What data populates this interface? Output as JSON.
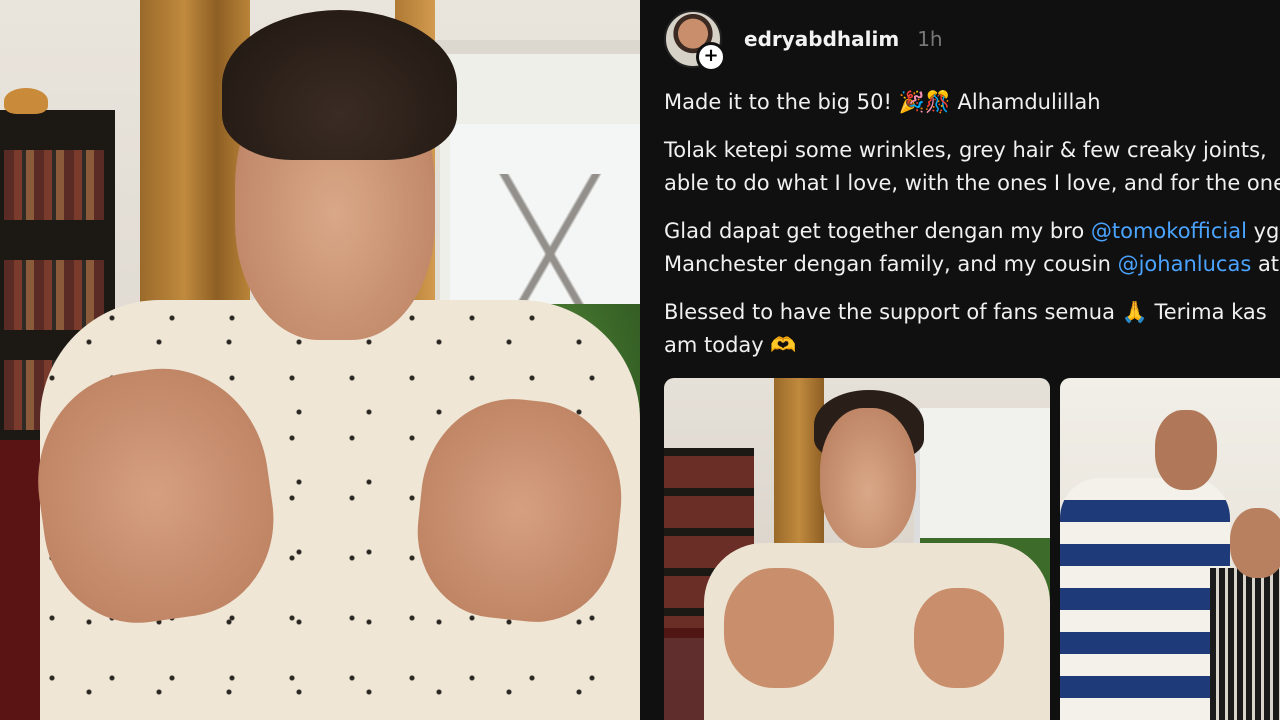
{
  "post": {
    "username": "edryabdhalim",
    "time": "1h",
    "follow_icon": "plus-icon",
    "caption": {
      "line1": "Made it to the big 50! 🎉🎊 Alhamdulillah",
      "p2_line1": "Tolak ketepi some wrinkles, grey hair & few creaky joints,",
      "p2_line2": "able to do what I love, with the ones I love, and for the one",
      "p3_pre": "Glad dapat get together dengan my bro ",
      "p3_mention1": "@tomokofficial",
      "p3_post1": " yg",
      "p3_line2_pre": "Manchester dengan family, and my cousin ",
      "p3_mention2": "@johanlucas",
      "p3_post2": " at",
      "p4_line1": "Blessed to have the support of fans semua 🙏 Terima kas",
      "p4_line2": "am today 🫶"
    },
    "mention_color": "#4aa3ff"
  }
}
